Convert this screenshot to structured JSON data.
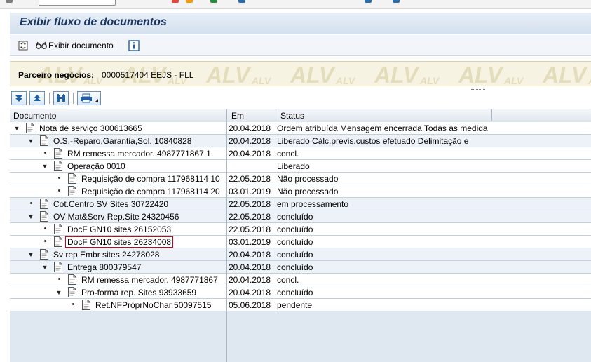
{
  "window": {
    "title": "Exibir fluxo de documentos"
  },
  "toolbar": {
    "display_document_label": "Exibir documento"
  },
  "header": {
    "partner_label": "Parceiro negócios:",
    "partner_value": "0000517404 EEJS - FLL",
    "watermark": "ALV"
  },
  "table": {
    "columns": [
      "Documento",
      "Em",
      "Status"
    ],
    "rows": [
      {
        "level": 0,
        "node": "open",
        "doc": "Nota de serviço 300613665",
        "date": "20.04.2018",
        "status": "Ordem atribuída Mensagem encerrada Todas as medida",
        "style": "plain"
      },
      {
        "level": 1,
        "node": "open",
        "doc": "O.S.-Reparo,Garantia,Sol. 10840828",
        "date": "20.04.2018",
        "status": "Liberado Cálc.previs.custos efetuado Delimitação e",
        "style": "alt"
      },
      {
        "level": 2,
        "node": "leaf",
        "doc": "RM remessa mercador. 4987771867 1",
        "date": "20.04.2018",
        "status": "concl.",
        "style": "plain"
      },
      {
        "level": 2,
        "node": "open",
        "doc": "Operação 0010",
        "date": "",
        "status": "Liberado",
        "style": "plain"
      },
      {
        "level": 3,
        "node": "leaf",
        "doc": "Requisição de compra 117968114 10",
        "date": "22.05.2018",
        "status": "Não processado",
        "style": "plain"
      },
      {
        "level": 3,
        "node": "leaf",
        "doc": "Requisição de compra 117968114 20",
        "date": "03.01.2019",
        "status": "Não processado",
        "style": "plain"
      },
      {
        "level": 1,
        "node": "leaf",
        "doc": "Cot.Centro SV Sites 30722420",
        "date": "22.05.2018",
        "status": "em processamento",
        "style": "alt"
      },
      {
        "level": 1,
        "node": "open",
        "doc": "OV Mat&Serv Rep.Site 24320456",
        "date": "22.05.2018",
        "status": "concluído",
        "style": "alt"
      },
      {
        "level": 2,
        "node": "leaf",
        "doc": "DocF GN10 sites 26152053",
        "date": "22.05.2018",
        "status": "concluído",
        "style": "plain"
      },
      {
        "level": 2,
        "node": "leaf",
        "doc": "DocF GN10 sites 26234008",
        "date": "03.01.2019",
        "status": "concluído",
        "style": "plain",
        "selected": true
      },
      {
        "level": 1,
        "node": "open",
        "doc": "Sv rep Embr sites 24278028",
        "date": "20.04.2018",
        "status": "concluído",
        "style": "alt"
      },
      {
        "level": 2,
        "node": "open",
        "doc": "Entrega 800379547",
        "date": "20.04.2018",
        "status": "concluído",
        "style": "alt"
      },
      {
        "level": 3,
        "node": "leaf",
        "doc": "RM remessa mercador. 4987771867",
        "date": "20.04.2018",
        "status": "concl.",
        "style": "plain"
      },
      {
        "level": 3,
        "node": "open",
        "doc": "Pro-forma rep. Sites 93933659",
        "date": "20.04.2018",
        "status": "concluído",
        "style": "plain"
      },
      {
        "level": 4,
        "node": "leaf",
        "doc": "Ret.NFPróprNoChar 50097515",
        "date": "05.06.2018",
        "status": "pendente",
        "style": "plain"
      }
    ]
  },
  "colors": {
    "title_text": "#1a3560",
    "selection_outline": "#d0021b",
    "row_alt": "#edf2f8",
    "empty_area": "#dfe7f1"
  }
}
